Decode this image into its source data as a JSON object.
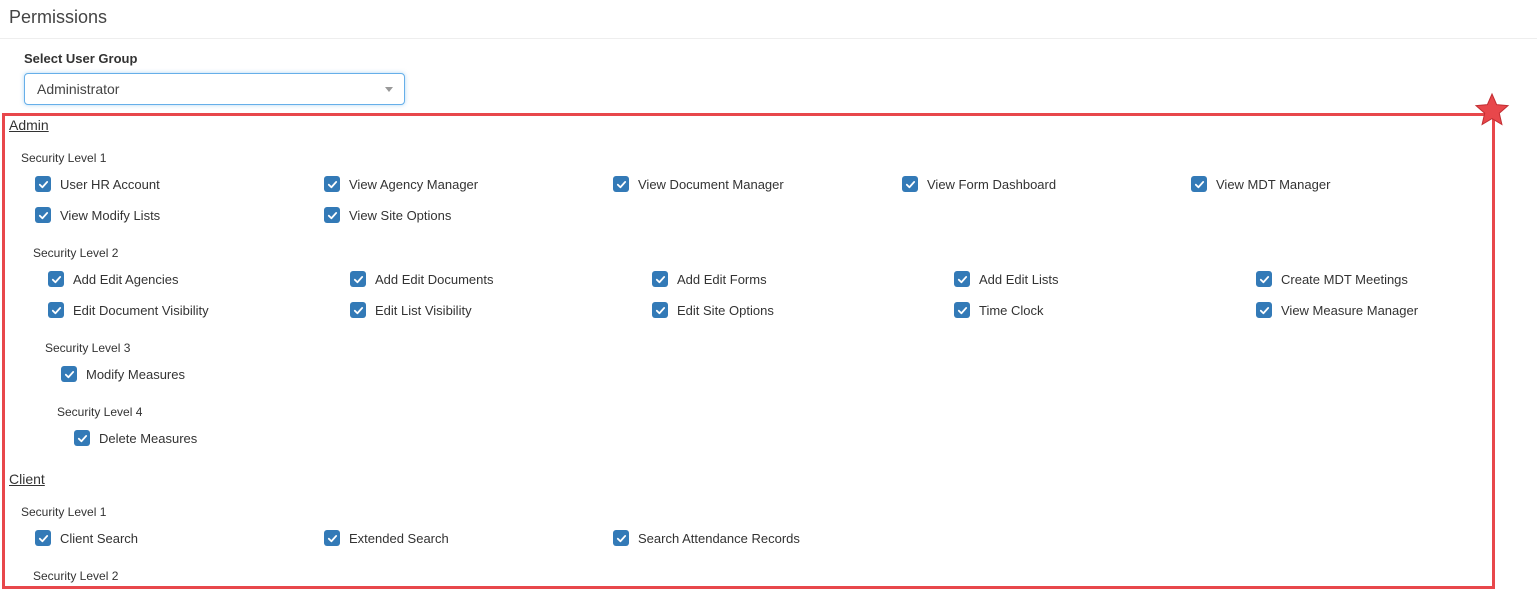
{
  "page": {
    "title": "Permissions"
  },
  "user_group": {
    "label": "Select User Group",
    "selected": "Administrator"
  },
  "sections": [
    {
      "title": "Admin",
      "levels": [
        {
          "label": "Security Level 1",
          "items": [
            "User HR Account",
            "View Agency Manager",
            "View Document Manager",
            "View Form Dashboard",
            "View MDT Manager",
            "View Modify Lists",
            "View Site Options"
          ]
        },
        {
          "label": "Security Level 2",
          "items": [
            "Add Edit Agencies",
            "Add Edit Documents",
            "Add Edit Forms",
            "Add Edit Lists",
            "Create MDT Meetings",
            "Edit Document Visibility",
            "Edit List Visibility",
            "Edit Site Options",
            "Time Clock",
            "View Measure Manager"
          ]
        },
        {
          "label": "Security Level 3",
          "items": [
            "Modify Measures"
          ]
        },
        {
          "label": "Security Level 4",
          "items": [
            "Delete Measures"
          ]
        }
      ]
    },
    {
      "title": "Client",
      "levels": [
        {
          "label": "Security Level 1",
          "items": [
            "Client Search",
            "Extended Search",
            "Search Attendance Records"
          ]
        },
        {
          "label": "Security Level 2",
          "items": []
        }
      ]
    }
  ],
  "colors": {
    "checkbox": "#337ab7",
    "highlight": "#e8474b",
    "focus_border": "#66afe9"
  },
  "icons": {
    "checkbox_checked": "check-icon",
    "star": "star-icon",
    "select_caret": "caret-down-icon"
  }
}
